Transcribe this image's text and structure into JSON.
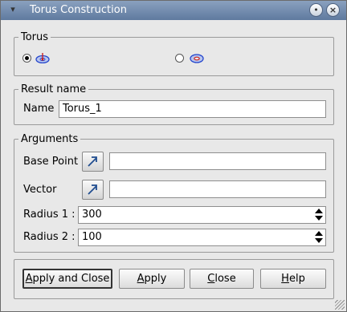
{
  "window": {
    "title": "Torus Construction",
    "icons": {
      "app": "pin-icon",
      "minimize": "minimize-icon",
      "close": "close-icon"
    }
  },
  "torus_group": {
    "legend": "Torus",
    "options": [
      {
        "icon": "torus-point-vector-icon",
        "checked": true
      },
      {
        "icon": "torus-icon",
        "checked": false
      }
    ]
  },
  "result_group": {
    "legend": "Result name",
    "name_label": "Name",
    "name_value": "Torus_1"
  },
  "arguments_group": {
    "legend": "Arguments",
    "base_point_label": "Base Point",
    "base_point_value": "",
    "vector_label": "Vector",
    "vector_value": "",
    "radius1_label": "Radius 1 :",
    "radius1_value": "300",
    "radius2_label": "Radius 2 :",
    "radius2_value": "100"
  },
  "buttons": {
    "apply_close": {
      "mnemonic": "A",
      "rest": "pply and Close"
    },
    "apply": {
      "mnemonic": "A",
      "rest": "pply"
    },
    "close": {
      "mnemonic": "C",
      "rest": "lose"
    },
    "help": {
      "mnemonic": "H",
      "rest": "elp"
    }
  },
  "colors": {
    "titlebar": "#6f88ab",
    "window_bg": "#e8e8e8",
    "icon_blue": "#2244cc",
    "icon_red": "#cc2222"
  }
}
